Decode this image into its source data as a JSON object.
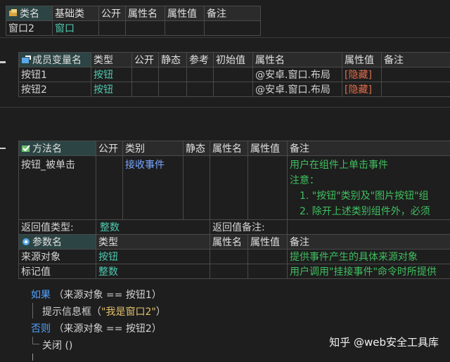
{
  "class_table": {
    "headers": [
      "类名",
      "基础类",
      "公开",
      "属性名",
      "属性值",
      "备注"
    ],
    "row": [
      "窗口2",
      "窗口",
      "",
      "",
      "",
      ""
    ]
  },
  "member_table": {
    "headers": [
      "成员变量名",
      "类型",
      "公开",
      "静态",
      "参考",
      "初始值",
      "属性名",
      "属性值",
      "备注"
    ],
    "rows": [
      {
        "name": "按钮1",
        "type": "按钮",
        "pub": "",
        "static": "",
        "ref": "",
        "init": "",
        "attr_name": "@安卓.窗口.布局",
        "attr_val": "[隐藏]",
        "note": ""
      },
      {
        "name": "按钮2",
        "type": "按钮",
        "pub": "",
        "static": "",
        "ref": "",
        "init": "",
        "attr_name": "@安卓.窗口.布局",
        "attr_val": "[隐藏]",
        "note": ""
      }
    ]
  },
  "method_table": {
    "headers": [
      "方法名",
      "公开",
      "类别",
      "静态",
      "属性名",
      "属性值",
      "备注"
    ],
    "method": {
      "name": "按钮_被单击",
      "category": "接收事件"
    },
    "notes": [
      "用户在组件上单击事件",
      "注意：",
      "1. \"按钮\"类别及\"图片按钮\"组",
      "2. 除开上述类别组件外，必须"
    ],
    "return_type_label": "返回值类型:",
    "return_type": "整数",
    "return_note_label": "返回值备注:",
    "param_headers": [
      "参数名",
      "类型",
      "属性名",
      "属性值",
      "备注"
    ],
    "params": [
      {
        "name": "来源对象",
        "type": "按钮",
        "note": "提供事件产生的具体来源对象"
      },
      {
        "name": "标记值",
        "type": "整数",
        "note": "用户调用\"挂接事件\"命令时所提供"
      }
    ]
  },
  "code": {
    "line1_kw": "如果",
    "line1_rest": "（来源对象 == 按钮1）",
    "line2_fn": "提示信息框",
    "line2_open": "（",
    "line2_str": "\"我是窗口2\"",
    "line2_close": "）",
    "line3_kw": "否则",
    "line3_rest": "（来源对象 == 按钮2）",
    "line4": "关闭 ()"
  },
  "watermark": "知乎 @web安全工具库",
  "colors": {
    "type": "#4ec9b0",
    "category": "#79a6ff",
    "note": "#3fbf5f",
    "keyword": "#4fa3ff",
    "string": "#e2c06a",
    "attr_value": "#e06c4b"
  }
}
